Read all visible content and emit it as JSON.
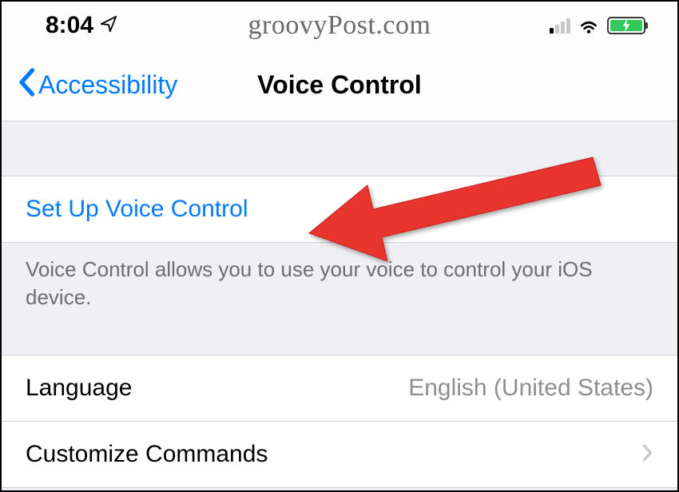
{
  "status": {
    "time": "8:04",
    "watermark": "groovyPost.com"
  },
  "nav": {
    "back_label": "Accessibility",
    "title": "Voice Control"
  },
  "setup": {
    "label": "Set Up Voice Control",
    "footer": "Voice Control allows you to use your voice to control your iOS device."
  },
  "options": {
    "language_label": "Language",
    "language_value": "English (United States)",
    "customize_label": "Customize Commands"
  }
}
